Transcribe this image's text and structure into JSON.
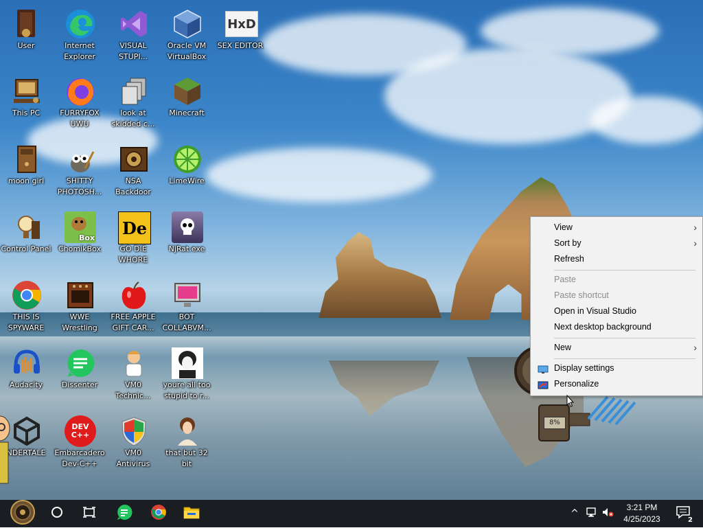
{
  "desktop_icons": [
    {
      "label": "User",
      "icon": "user-folder-icon"
    },
    {
      "label": "Internet Explorer",
      "icon": "edge-icon"
    },
    {
      "label": "VISUAL STUPI...",
      "icon": "visual-studio-icon"
    },
    {
      "label": "Oracle VM VirtualBox",
      "icon": "virtualbox-icon"
    },
    {
      "label": "SEX EDITOR",
      "icon": "hxd-icon",
      "icon_text": "HxD"
    },
    {
      "label": "This PC",
      "icon": "computer-icon"
    },
    {
      "label": "FURRYFOX UWU",
      "icon": "firefox-icon"
    },
    {
      "label": "look at skidded c...",
      "icon": "files-icon"
    },
    {
      "label": "Minecraft",
      "icon": "minecraft-icon"
    },
    {
      "label": "moon girl",
      "icon": "book-icon"
    },
    {
      "label": "SHITTY PHOTOSH...",
      "icon": "gimp-icon"
    },
    {
      "label": "NSA Backdoor",
      "icon": "steampunk-box-icon"
    },
    {
      "label": "LimeWire",
      "icon": "limewire-icon"
    },
    {
      "label": "Control Panel",
      "icon": "lamp-icon"
    },
    {
      "label": "ChomikBox",
      "icon": "chomikbox-icon",
      "icon_text": "Box"
    },
    {
      "label": "GO DIE WHORE",
      "icon": "de-icon",
      "icon_text": "De"
    },
    {
      "label": "NjRat.exe",
      "icon": "skull-icon"
    },
    {
      "label": "THIS IS SPYWARE",
      "icon": "chrome-icon"
    },
    {
      "label": "WWE Wrestling",
      "icon": "oven-icon"
    },
    {
      "label": "FREE APPLE GIFT CAR...",
      "icon": "apple-icon"
    },
    {
      "label": "BOT COLLABVM...",
      "icon": "monitor-icon"
    },
    {
      "label": "Audacity",
      "icon": "audacity-icon"
    },
    {
      "label": "Dissenter",
      "icon": "chat-icon"
    },
    {
      "label": "VM0 Technic...",
      "icon": "technician-icon"
    },
    {
      "label": "youre all too stupid to r...",
      "icon": "portrait-icon"
    },
    {
      "label": "NDERTALE",
      "icon": "unity-icon"
    },
    {
      "label": "Embarcadero Dev-C++",
      "icon": "devcpp-icon",
      "icon_text": "DEV C++"
    },
    {
      "label": "VM0 Antivirus",
      "icon": "shield-icon"
    },
    {
      "label": "that but 32 bit",
      "icon": "portrait-icon"
    }
  ],
  "context_menu": {
    "items": [
      {
        "label": "View",
        "enabled": true,
        "submenu": true
      },
      {
        "label": "Sort by",
        "enabled": true,
        "submenu": true
      },
      {
        "label": "Refresh",
        "enabled": true
      },
      {
        "label": "Paste",
        "enabled": false
      },
      {
        "label": "Paste shortcut",
        "enabled": false
      },
      {
        "label": "Open in Visual Studio",
        "enabled": true
      },
      {
        "label": "Next desktop background",
        "enabled": true
      },
      {
        "label": "New",
        "enabled": true,
        "submenu": true
      },
      {
        "label": "Display settings",
        "enabled": true,
        "icon": "display-icon"
      },
      {
        "label": "Personalize",
        "enabled": true,
        "icon": "personalize-icon"
      }
    ],
    "submenu_arrow": "›"
  },
  "gadget": {
    "percent": "8%"
  },
  "taskbar": {
    "pinned": [
      "start-icon",
      "cortana-circle-icon",
      "task-view-icon",
      "dissenter-icon",
      "chrome-icon",
      "file-explorer-icon"
    ],
    "tray": {
      "chevron": "^",
      "time": "3:21 PM",
      "date": "4/25/2023",
      "notification_count": "2"
    }
  },
  "colors": {
    "taskbar": "#1a1d22",
    "menu_bg": "#f2f2f2",
    "menu_disabled": "#8c8c8c"
  }
}
